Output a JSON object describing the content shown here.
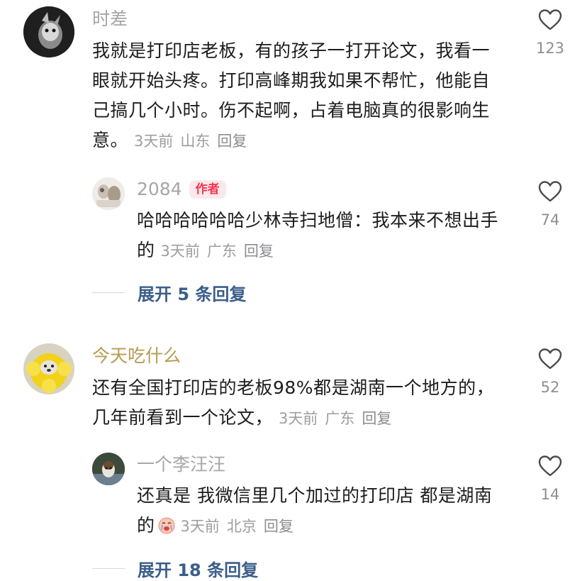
{
  "comments": [
    {
      "username": "时差",
      "text": "我就是打印店老板，有的孩子一打开论文，我看一眼就开始头疼。打印高峰期我如果不帮忙，他能自己搞几个小时。伤不起啊，占着电脑真的很影响生意。",
      "time": "3天前",
      "location": "山东",
      "reply_label": "回复",
      "like_count": "123",
      "reply": {
        "username": "2084",
        "badge": "作者",
        "text": "哈哈哈哈哈哈少林寺扫地僧：我本来不想出手的",
        "time": "3天前",
        "location": "广东",
        "reply_label": "回复",
        "like_count": "74"
      },
      "expand_label": "展开 5 条回复"
    },
    {
      "username": "今天吃什么",
      "username_color": "#b59b52",
      "text": "还有全国打印店的老板98%都是湖南一个地方的，几年前看到一个论文，",
      "time": "3天前",
      "location": "广东",
      "reply_label": "回复",
      "like_count": "52",
      "reply": {
        "username": "一个李汪汪",
        "text": "还真是 我微信里几个加过的打印店 都是湖南的",
        "emoji": "crying-face-icon",
        "time": "3天前",
        "location": "北京",
        "reply_label": "回复",
        "like_count": "14"
      },
      "expand_label": "展开 18 条回复"
    }
  ],
  "colors": {
    "body_text": "#1c1c1e",
    "username": "#a6a6ab",
    "meta": "#9d9da2",
    "expand_link": "#3b5d8a",
    "badge_bg": "#fde8ea",
    "badge_text": "#f2364f"
  }
}
